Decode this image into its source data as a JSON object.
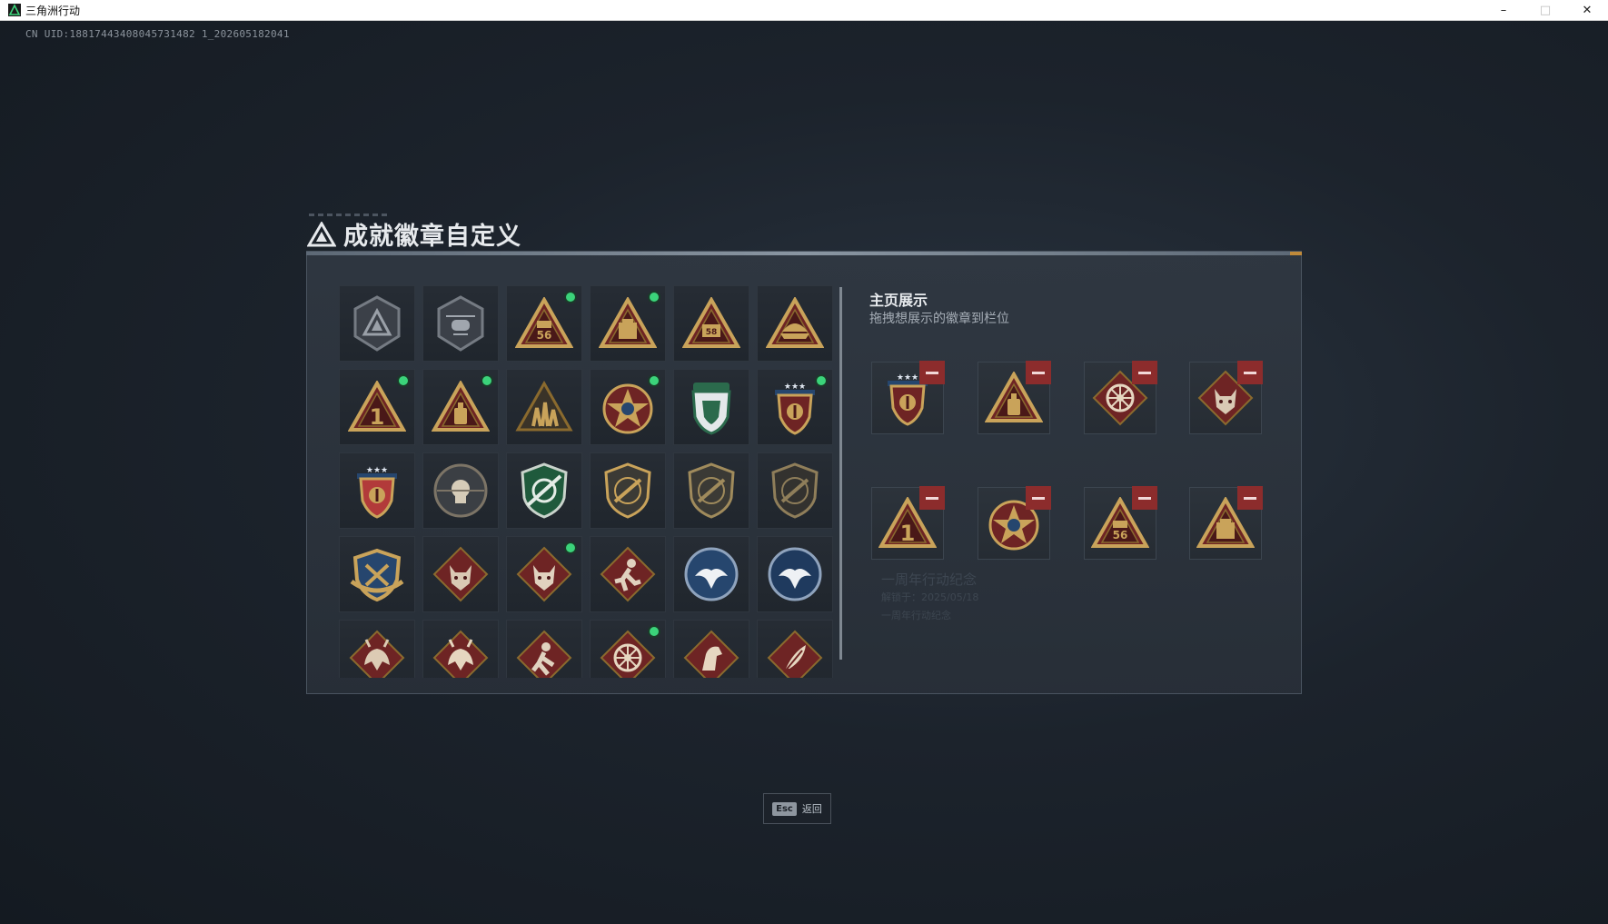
{
  "window": {
    "title": "三角洲行动",
    "minimize": "–",
    "maximize": "□",
    "close": "✕"
  },
  "uid_line": "CN UID:18817443408045731482 1_202605182041",
  "panel": {
    "title": "成就徽章自定义"
  },
  "showcase": {
    "title": "主页展示",
    "subtitle": "拖拽想展示的徽章到栏位"
  },
  "badges": [
    {
      "icon": "gray-delta-shield-icon",
      "new": false
    },
    {
      "icon": "helicopter-shield-icon",
      "new": false
    },
    {
      "icon": "delta-56-badge-icon",
      "new": true
    },
    {
      "icon": "delta-ammo-box-icon",
      "new": true
    },
    {
      "icon": "delta-58-badge-icon",
      "new": false
    },
    {
      "icon": "delta-ship-badge-icon",
      "new": false
    },
    {
      "icon": "delta-number-one-icon",
      "new": true
    },
    {
      "icon": "delta-bottle-icon",
      "new": true
    },
    {
      "icon": "delta-soldiers-icon",
      "new": false
    },
    {
      "icon": "star-wreath-medal-icon",
      "new": true
    },
    {
      "icon": "green-shield-crest-icon",
      "new": false
    },
    {
      "icon": "three-star-red-crest-icon",
      "new": true
    },
    {
      "icon": "three-star-blue-crest-icon",
      "new": false
    },
    {
      "icon": "skull-round-badge-icon",
      "new": false
    },
    {
      "icon": "green-crosshair-shield-icon",
      "new": false
    },
    {
      "icon": "rifle-round-badge-icon",
      "new": false
    },
    {
      "icon": "rifle-round-badge-2-icon",
      "new": false
    },
    {
      "icon": "rifle-round-badge-3-icon",
      "new": false
    },
    {
      "icon": "winged-gold-crest-icon",
      "new": false
    },
    {
      "icon": "wolf-diamond-icon",
      "new": false
    },
    {
      "icon": "wolf-diamond-2-icon",
      "new": true
    },
    {
      "icon": "runner-diamond-icon",
      "new": false
    },
    {
      "icon": "eagle-blue-round-icon",
      "new": false
    },
    {
      "icon": "eagle-blue-round-2-icon",
      "new": false
    },
    {
      "icon": "dragon-diamond-icon",
      "new": false
    },
    {
      "icon": "dragon-diamond-2-icon",
      "new": false
    },
    {
      "icon": "runner-diamond-2-icon",
      "new": false
    },
    {
      "icon": "wheel-diamond-icon",
      "new": true
    },
    {
      "icon": "horse-diamond-icon",
      "new": false
    },
    {
      "icon": "feather-diamond-icon",
      "new": false
    }
  ],
  "slots": [
    {
      "icon": "three-star-red-crest-icon"
    },
    {
      "icon": "delta-bottle-icon"
    },
    {
      "icon": "wheel-diamond-icon"
    },
    {
      "icon": "wolf-diamond-icon"
    },
    {
      "icon": "delta-number-one-icon"
    },
    {
      "icon": "star-wreath-medal-icon"
    },
    {
      "icon": "delta-56-badge-icon"
    },
    {
      "icon": "delta-ammo-box-icon"
    }
  ],
  "ghost": {
    "line1": "一周年行动纪念",
    "line2": "解锁于：2025/05/18",
    "line3": "一周年行动纪念"
  },
  "esc": {
    "key": "Esc",
    "label": "返回"
  },
  "colors": {
    "new_dot": "#3bd37a",
    "remove_red": "#8c2c2c",
    "gold": "#c9a35a",
    "dark_red": "#6e2424"
  }
}
